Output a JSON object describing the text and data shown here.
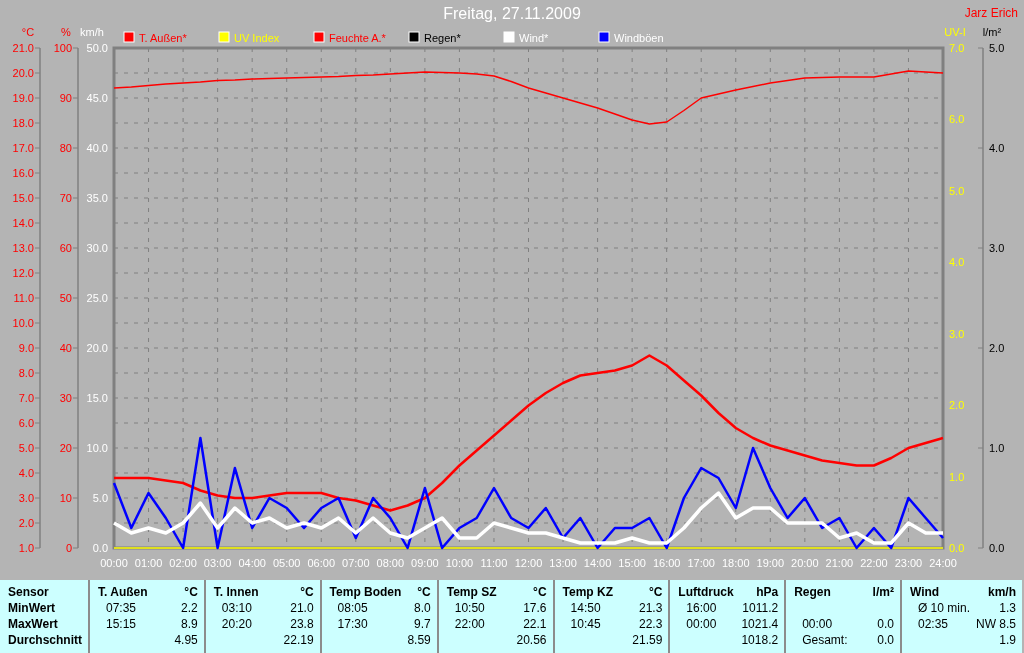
{
  "header": {
    "title": "Freitag, 27.11.2009",
    "author": "Jarz Erich"
  },
  "chart_data": {
    "type": "line",
    "grid": true,
    "legend": "top",
    "ylabel": "km/h",
    "ylim": [
      0,
      50
    ],
    "yticks": [
      {
        "value": 0,
        "label": "0.0"
      },
      {
        "value": 5,
        "label": "5.0"
      },
      {
        "value": 10,
        "label": "10.0"
      },
      {
        "value": 15,
        "label": "15.0"
      },
      {
        "value": 20,
        "label": "20.0"
      },
      {
        "value": 25,
        "label": "25.0"
      },
      {
        "value": 30,
        "label": "30.0"
      },
      {
        "value": 35,
        "label": "35.0"
      },
      {
        "value": 40,
        "label": "40.0"
      },
      {
        "value": 45,
        "label": "45.0"
      },
      {
        "value": 50,
        "label": "50.0"
      }
    ],
    "y2label": "°C",
    "y2lim": [
      1,
      21
    ],
    "y2ticks": [
      {
        "value": 1,
        "label": "1.0"
      },
      {
        "value": 2,
        "label": "2.0"
      },
      {
        "value": 3,
        "label": "3.0"
      },
      {
        "value": 4,
        "label": "4.0"
      },
      {
        "value": 5,
        "label": "5.0"
      },
      {
        "value": 6,
        "label": "6.0"
      },
      {
        "value": 7,
        "label": "7.0"
      },
      {
        "value": 8,
        "label": "8.0"
      },
      {
        "value": 9,
        "label": "9.0"
      },
      {
        "value": 10,
        "label": "10.0"
      },
      {
        "value": 11,
        "label": "11.0"
      },
      {
        "value": 12,
        "label": "12.0"
      },
      {
        "value": 13,
        "label": "13.0"
      },
      {
        "value": 14,
        "label": "14.0"
      },
      {
        "value": 15,
        "label": "15.0"
      },
      {
        "value": 16,
        "label": "16.0"
      },
      {
        "value": 17,
        "label": "17.0"
      },
      {
        "value": 18,
        "label": "18.0"
      },
      {
        "value": 19,
        "label": "19.0"
      },
      {
        "value": 20,
        "label": "20.0"
      },
      {
        "value": 21,
        "label": "21.0"
      }
    ],
    "y3label": "%",
    "y3lim": [
      0,
      100
    ],
    "y3ticks": [
      0,
      10,
      20,
      30,
      40,
      50,
      60,
      70,
      80,
      90,
      100
    ],
    "xlim": [
      0,
      24
    ],
    "xticks": [
      {
        "value": 0,
        "label": "00:00"
      },
      {
        "value": 1,
        "label": "01:00"
      },
      {
        "value": 2,
        "label": "02:00"
      },
      {
        "value": 3,
        "label": "03:00"
      },
      {
        "value": 4,
        "label": "04:00"
      },
      {
        "value": 5,
        "label": "05:00"
      },
      {
        "value": 6,
        "label": "06:00"
      },
      {
        "value": 7,
        "label": "07:00"
      },
      {
        "value": 8,
        "label": "08:00"
      },
      {
        "value": 9,
        "label": "09:00"
      },
      {
        "value": 10,
        "label": "10:00"
      },
      {
        "value": 11,
        "label": "11:00"
      },
      {
        "value": 12,
        "label": "12:00"
      },
      {
        "value": 13,
        "label": "13:00"
      },
      {
        "value": 14,
        "label": "14:00"
      },
      {
        "value": 15,
        "label": "15:00"
      },
      {
        "value": 16,
        "label": "16:00"
      },
      {
        "value": 17,
        "label": "17:00"
      },
      {
        "value": 18,
        "label": "18:00"
      },
      {
        "value": 19,
        "label": "19:00"
      },
      {
        "value": 20,
        "label": "20:00"
      },
      {
        "value": 21,
        "label": "21:00"
      },
      {
        "value": 22,
        "label": "22:00"
      },
      {
        "value": 23,
        "label": "23:00"
      },
      {
        "value": 24,
        "label": "24:00"
      }
    ],
    "x": [
      0,
      0.5,
      1,
      1.5,
      2,
      2.5,
      3,
      3.5,
      4,
      4.5,
      5,
      5.5,
      6,
      6.5,
      7,
      7.5,
      8,
      8.5,
      9,
      9.5,
      10,
      10.5,
      11,
      11.5,
      12,
      12.5,
      13,
      13.5,
      14,
      14.5,
      15,
      15.5,
      16,
      16.5,
      17,
      17.5,
      18,
      18.5,
      19,
      19.5,
      20,
      20.5,
      21,
      21.5,
      22,
      22.5,
      23,
      23.5,
      24
    ],
    "series": [
      {
        "name": "T. Außen*",
        "color": "#ff0000",
        "axis": "y2",
        "values": [
          3.8,
          3.8,
          3.8,
          3.7,
          3.6,
          3.3,
          3.1,
          3.0,
          3.0,
          3.1,
          3.2,
          3.2,
          3.2,
          3.0,
          2.9,
          2.7,
          2.5,
          2.7,
          3.0,
          3.6,
          4.3,
          4.9,
          5.5,
          6.1,
          6.7,
          7.2,
          7.6,
          7.9,
          8.0,
          8.1,
          8.3,
          8.7,
          8.3,
          7.7,
          7.1,
          6.4,
          5.8,
          5.4,
          5.1,
          4.9,
          4.7,
          4.5,
          4.4,
          4.3,
          4.3,
          4.6,
          5.0,
          5.2,
          5.4
        ]
      },
      {
        "name": "UV Index",
        "color": "#ffff00",
        "values": [
          0,
          0,
          0,
          0,
          0,
          0,
          0,
          0,
          0,
          0,
          0,
          0,
          0,
          0,
          0,
          0,
          0,
          0,
          0,
          0,
          0,
          0,
          0,
          0,
          0,
          0,
          0,
          0,
          0,
          0,
          0,
          0,
          0,
          0,
          0,
          0,
          0,
          0,
          0,
          0,
          0,
          0,
          0,
          0,
          0,
          0,
          0,
          0,
          0
        ]
      },
      {
        "name": "Feuchte A.*",
        "color": "#ff0000",
        "axis": "y3",
        "values": [
          92,
          92.2,
          92.5,
          92.8,
          93,
          93.2,
          93.5,
          93.6,
          93.8,
          93.9,
          94,
          94.1,
          94.2,
          94.3,
          94.5,
          94.6,
          94.8,
          95,
          95.2,
          95.1,
          95,
          94.8,
          94.4,
          93.3,
          92,
          91,
          90,
          89,
          88,
          86.8,
          85.6,
          84.8,
          85.2,
          87.5,
          90,
          90.8,
          91.6,
          92.3,
          93,
          93.5,
          94,
          94.1,
          94.2,
          94.2,
          94.2,
          94.8,
          95.4,
          95.2,
          95
        ]
      },
      {
        "name": "Regen*",
        "color": "#000000",
        "values": [
          null,
          null,
          null,
          null,
          null,
          null,
          null,
          null,
          null,
          null,
          null,
          null,
          null,
          null,
          null,
          null,
          null,
          null,
          null,
          null,
          null,
          null,
          null,
          null,
          null,
          null,
          null,
          null,
          null,
          null,
          null,
          null,
          null,
          null,
          null,
          null,
          null,
          null,
          null,
          null,
          null,
          null,
          null,
          null,
          null,
          null,
          null,
          null,
          null
        ]
      },
      {
        "name": "Wind*",
        "color": "#ffffff",
        "values": [
          2.5,
          1.5,
          2,
          1.5,
          2.5,
          4.5,
          2,
          4,
          2.5,
          3,
          2,
          2.5,
          2,
          3,
          1.5,
          3,
          1.5,
          1,
          2,
          3,
          1,
          1,
          2.5,
          2,
          1.5,
          1.5,
          1,
          0.5,
          0.5,
          0.5,
          1,
          0.5,
          0.5,
          2,
          4,
          5.5,
          3,
          4,
          4,
          2.5,
          2.5,
          2.5,
          1,
          1.5,
          0.5,
          0.5,
          2.5,
          1.5,
          1.5
        ]
      },
      {
        "name": "Windböen",
        "color": "#0000ff",
        "values": [
          6.5,
          2,
          5.5,
          3,
          0,
          11,
          0,
          8,
          2,
          5,
          4,
          2,
          4,
          5,
          1,
          5,
          3,
          0,
          6,
          0,
          2,
          3,
          6,
          3,
          2,
          4,
          1,
          3,
          0,
          2,
          2,
          3,
          0,
          5,
          8,
          7,
          4,
          10,
          6,
          3,
          5,
          2,
          3,
          0,
          2,
          0,
          5,
          3,
          1
        ]
      }
    ]
  },
  "side_axes": [
    {
      "unit": "UV-I",
      "color": "#ffff00",
      "labels": [
        "7.0",
        "6.0",
        "5.0",
        "4.0",
        "3.0",
        "2.0",
        "1.0",
        "0.0"
      ]
    },
    {
      "unit": "l/m²",
      "color": "#000000",
      "labels": [
        "5.0",
        "4.0",
        "3.0",
        "2.0",
        "1.0",
        "0.0"
      ]
    }
  ],
  "stats": {
    "row_labels": [
      "Sensor",
      "MinWert",
      "MaxWert",
      "Durchschnitt"
    ],
    "sensors": [
      {
        "name": "T. Außen",
        "unit": "°C",
        "rows": [
          {
            "note": "07:35",
            "value": "2.2"
          },
          {
            "note": "15:15",
            "value": "8.9"
          },
          {
            "value": "4.95"
          }
        ]
      },
      {
        "name": "T. Innen",
        "unit": "°C",
        "rows": [
          {
            "note": "03:10",
            "value": "21.0"
          },
          {
            "note": "20:20",
            "value": "23.8"
          },
          {
            "value": "22.19"
          }
        ]
      },
      {
        "name": "Temp Boden",
        "unit": "°C",
        "rows": [
          {
            "note": "08:05",
            "value": "8.0"
          },
          {
            "note": "17:30",
            "value": "9.7"
          },
          {
            "value": "8.59"
          }
        ]
      },
      {
        "name": "Temp SZ",
        "unit": "°C",
        "rows": [
          {
            "note": "10:50",
            "value": "17.6"
          },
          {
            "note": "22:00",
            "value": "22.1"
          },
          {
            "value": "20.56"
          }
        ]
      },
      {
        "name": "Temp KZ",
        "unit": "°C",
        "rows": [
          {
            "note": "14:50",
            "value": "21.3"
          },
          {
            "note": "10:45",
            "value": "22.3"
          },
          {
            "value": "21.59"
          }
        ]
      },
      {
        "name": "Luftdruck",
        "unit": "hPa",
        "rows": [
          {
            "note": "16:00",
            "value": "1011.2"
          },
          {
            "note": "00:00",
            "value": "1021.4"
          },
          {
            "value": "1018.2"
          }
        ]
      },
      {
        "name": "Regen",
        "unit": "l/m²",
        "rows": [
          {},
          {
            "note": "00:00",
            "value": "0.0"
          },
          {
            "note": "Gesamt:",
            "value": "0.0"
          }
        ]
      },
      {
        "name": "Wind",
        "unit": "km/h",
        "rows": [
          {
            "note": "Ø 10 min.",
            "value": "1.3"
          },
          {
            "note": "02:35",
            "value": "NW 8.5"
          },
          {
            "value": "1.9"
          }
        ]
      }
    ]
  }
}
